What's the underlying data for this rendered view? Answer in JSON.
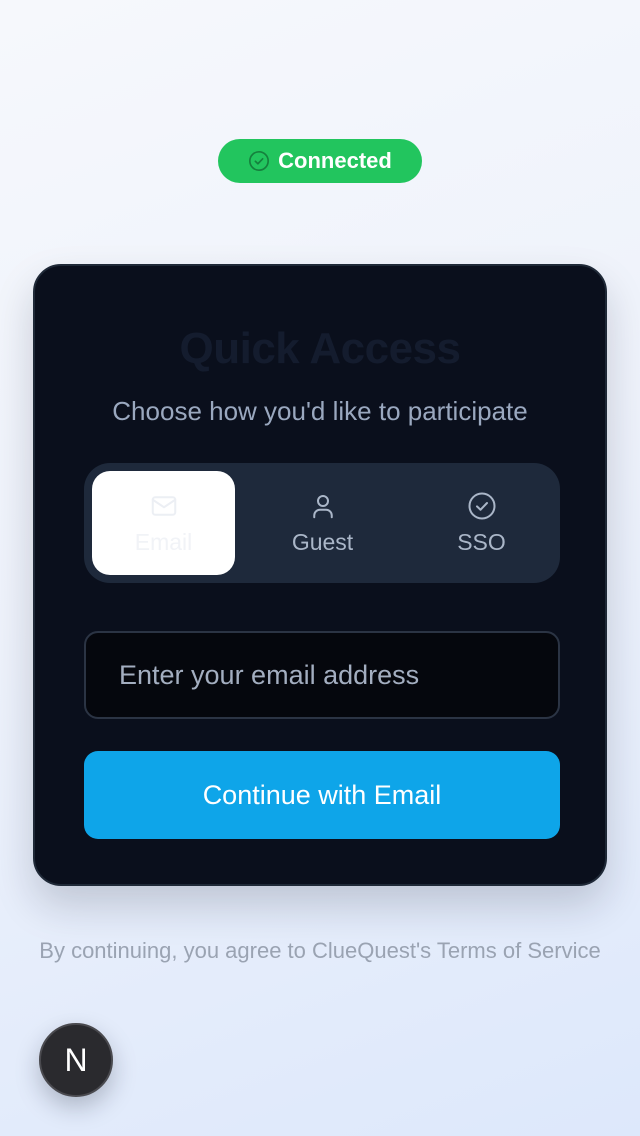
{
  "status": {
    "label": "Connected",
    "icon": "check-circle-icon",
    "color": "#22c55e"
  },
  "card": {
    "title": "Quick Access",
    "subtitle": "Choose how you'd like to participate"
  },
  "tabs": [
    {
      "label": "Email",
      "icon": "mail-icon",
      "active": true
    },
    {
      "label": "Guest",
      "icon": "user-icon",
      "active": false
    },
    {
      "label": "SSO",
      "icon": "check-circle-icon",
      "active": false
    }
  ],
  "email": {
    "placeholder": "Enter your email address",
    "value": ""
  },
  "continue_button": {
    "label": "Continue with Email",
    "color": "#0ea5e9"
  },
  "footer": {
    "terms": "By continuing, you agree to ClueQuest's Terms of Service"
  },
  "fab": {
    "label": "N"
  }
}
